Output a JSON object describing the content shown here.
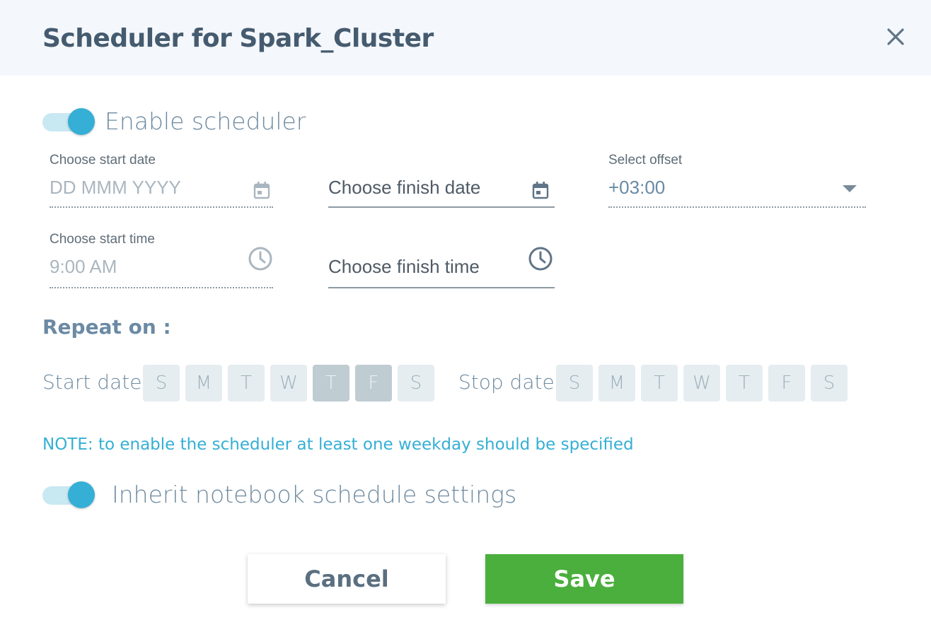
{
  "dialog": {
    "title_prefix": "Scheduler for",
    "title_name": "Spark_Cluster"
  },
  "enable_toggle": {
    "label": "Enable scheduler",
    "on": true
  },
  "start_date": {
    "label": "Choose start date",
    "placeholder": "DD MMM YYYY"
  },
  "finish_date": {
    "placeholder": "Choose finish date"
  },
  "offset": {
    "label": "Select offset",
    "value": "+03:00"
  },
  "start_time": {
    "label": "Choose start time",
    "value": "9:00 AM"
  },
  "finish_time": {
    "placeholder": "Choose finish time"
  },
  "repeat": {
    "title": "Repeat on :",
    "start_label": "Start date:",
    "stop_label": "Stop date:",
    "start_days": [
      {
        "d": "S",
        "active": false
      },
      {
        "d": "M",
        "active": false
      },
      {
        "d": "T",
        "active": false
      },
      {
        "d": "W",
        "active": false
      },
      {
        "d": "T",
        "active": true
      },
      {
        "d": "F",
        "active": true
      },
      {
        "d": "S",
        "active": false
      }
    ],
    "stop_days": [
      {
        "d": "S",
        "active": false
      },
      {
        "d": "M",
        "active": false
      },
      {
        "d": "T",
        "active": false
      },
      {
        "d": "W",
        "active": false
      },
      {
        "d": "T",
        "active": false
      },
      {
        "d": "F",
        "active": false
      },
      {
        "d": "S",
        "active": false
      }
    ]
  },
  "note": "NOTE: to enable the scheduler at least one weekday should be specified",
  "inherit_toggle": {
    "label": "Inherit notebook schedule settings",
    "on": true
  },
  "buttons": {
    "cancel": "Cancel",
    "save": "Save"
  },
  "colors": {
    "accent": "#35afd5",
    "save": "#4aaf3c"
  }
}
